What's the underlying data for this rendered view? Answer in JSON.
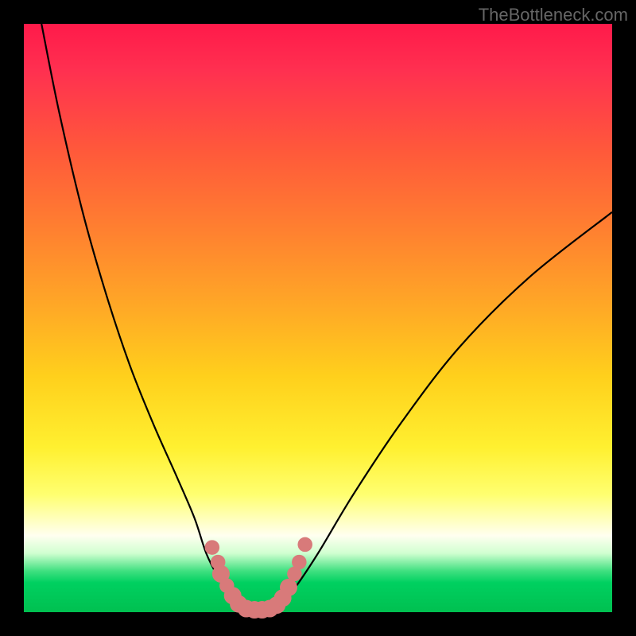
{
  "watermark": "TheBottleneck.com",
  "chart_data": {
    "type": "line",
    "title": "",
    "xlabel": "",
    "ylabel": "",
    "xlim": [
      0,
      100
    ],
    "ylim": [
      0,
      100
    ],
    "background_gradient": {
      "top": "#ff1a4a",
      "bottom": "#00c050"
    },
    "series": [
      {
        "name": "left-branch",
        "x": [
          3,
          6,
          10,
          14,
          18,
          22,
          26,
          29,
          31,
          33,
          35,
          36.5
        ],
        "y": [
          100,
          85,
          68,
          54,
          42,
          32,
          23,
          16,
          10,
          6,
          3,
          1
        ]
      },
      {
        "name": "valley-floor",
        "x": [
          36.5,
          38,
          40,
          42,
          43.5
        ],
        "y": [
          1,
          0.3,
          0.2,
          0.3,
          1
        ]
      },
      {
        "name": "right-branch",
        "x": [
          43.5,
          46,
          50,
          56,
          64,
          74,
          86,
          100
        ],
        "y": [
          1,
          4,
          10,
          20,
          32,
          45,
          57,
          68
        ]
      }
    ],
    "markers": [
      {
        "x": 32.0,
        "y": 11.0,
        "r": 1.6
      },
      {
        "x": 33.0,
        "y": 8.5,
        "r": 1.6
      },
      {
        "x": 33.5,
        "y": 6.5,
        "r": 1.9
      },
      {
        "x": 34.5,
        "y": 4.5,
        "r": 1.6
      },
      {
        "x": 35.5,
        "y": 2.8,
        "r": 1.9
      },
      {
        "x": 36.5,
        "y": 1.4,
        "r": 1.9
      },
      {
        "x": 37.8,
        "y": 0.6,
        "r": 1.9
      },
      {
        "x": 39.2,
        "y": 0.4,
        "r": 1.9
      },
      {
        "x": 40.5,
        "y": 0.4,
        "r": 1.9
      },
      {
        "x": 41.8,
        "y": 0.6,
        "r": 1.9
      },
      {
        "x": 43.0,
        "y": 1.2,
        "r": 1.9
      },
      {
        "x": 44.0,
        "y": 2.4,
        "r": 1.9
      },
      {
        "x": 45.0,
        "y": 4.2,
        "r": 1.9
      },
      {
        "x": 46.0,
        "y": 6.5,
        "r": 1.6
      },
      {
        "x": 46.8,
        "y": 8.5,
        "r": 1.6
      },
      {
        "x": 47.8,
        "y": 11.5,
        "r": 1.6
      }
    ]
  }
}
